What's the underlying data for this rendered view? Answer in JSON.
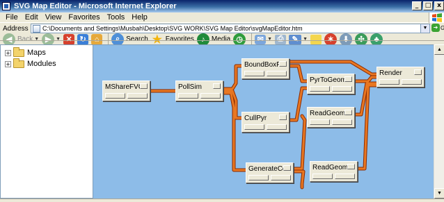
{
  "window": {
    "title": "SVG Map Editor - Microsoft Internet Explorer",
    "controls": [
      "_",
      "□",
      "x"
    ]
  },
  "menu": {
    "items": [
      "File",
      "Edit",
      "View",
      "Favorites",
      "Tools",
      "Help"
    ]
  },
  "address": {
    "label": "Address",
    "url": "C:\\Documents and Settings\\Musbah\\Desktop\\SVG WORK\\SVG Map Editor\\svgMapEditor.htm",
    "go_label": "Go"
  },
  "toolbar": {
    "back_label": "Back",
    "search_label": "Search",
    "favorites_label": "Favorites",
    "media_label": "Media",
    "icons": [
      "back-icon",
      "forward-icon",
      "stop-icon",
      "refresh-icon",
      "home-icon",
      "search-icon",
      "favorites-icon",
      "media-icon",
      "history-icon",
      "mail-icon",
      "print-icon",
      "edit-icon",
      "discuss-icon",
      "messenger-icon"
    ]
  },
  "tree": {
    "items": [
      {
        "label": "Maps",
        "expander": "+"
      },
      {
        "label": "Modules",
        "expander": "+"
      }
    ]
  },
  "canvas": {
    "nodes": [
      {
        "id": "mshare",
        "label": "MShareFVContr"
      },
      {
        "id": "pollsim",
        "label": "PollSim"
      },
      {
        "id": "boundbox",
        "label": "BoundBoxPyr"
      },
      {
        "id": "cullpyr",
        "label": "CullPyr"
      },
      {
        "id": "generatecolorm",
        "label": "GenerateColorm"
      },
      {
        "id": "pyrtogeom",
        "label": "PyrToGeom"
      },
      {
        "id": "readgeom1",
        "label": "ReadGeom"
      },
      {
        "id": "readgeom2",
        "label": "ReadGeom"
      },
      {
        "id": "render",
        "label": "Render"
      }
    ],
    "connection_color": "#e87722",
    "connection_outline": "#8a2a00",
    "background_color": "#8dbce8"
  }
}
